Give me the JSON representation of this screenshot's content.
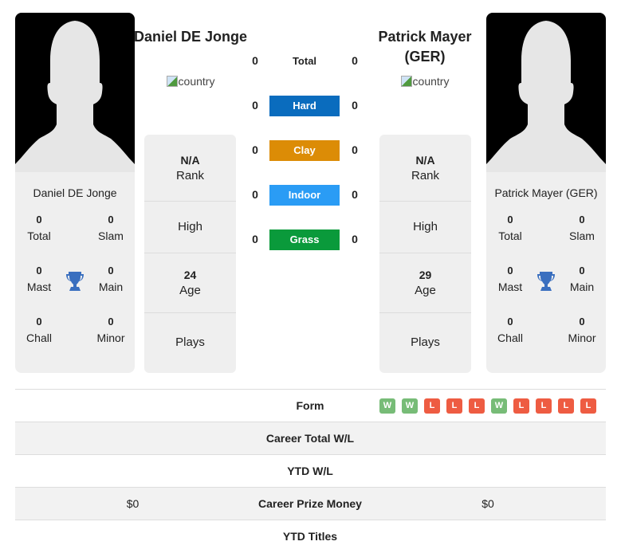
{
  "players": [
    {
      "heading_name": "Daniel DE Jonge",
      "card_name": "Daniel DE Jonge",
      "country_alt": "country",
      "rank": "N/A",
      "rank_label": "Rank",
      "high_label": "High",
      "age": "24",
      "age_label": "Age",
      "plays_label": "Plays",
      "titles": {
        "total": "0",
        "total_label": "Total",
        "slam": "0",
        "slam_label": "Slam",
        "mast": "0",
        "mast_label": "Mast",
        "main": "0",
        "main_label": "Main",
        "chall": "0",
        "chall_label": "Chall",
        "minor": "0",
        "minor_label": "Minor"
      }
    },
    {
      "heading_name": "Patrick Mayer (GER)",
      "card_name": "Patrick Mayer (GER)",
      "country_alt": "country",
      "rank": "N/A",
      "rank_label": "Rank",
      "high_label": "High",
      "age": "29",
      "age_label": "Age",
      "plays_label": "Plays",
      "titles": {
        "total": "0",
        "total_label": "Total",
        "slam": "0",
        "slam_label": "Slam",
        "mast": "0",
        "mast_label": "Mast",
        "main": "0",
        "main_label": "Main",
        "chall": "0",
        "chall_label": "Chall",
        "minor": "0",
        "minor_label": "Minor"
      }
    }
  ],
  "surfaces": [
    {
      "label": "Total",
      "left": "0",
      "right": "0",
      "color": ""
    },
    {
      "label": "Hard",
      "left": "0",
      "right": "0",
      "color": "#0a6cbe"
    },
    {
      "label": "Clay",
      "left": "0",
      "right": "0",
      "color": "#dc8c06"
    },
    {
      "label": "Indoor",
      "left": "0",
      "right": "0",
      "color": "#2a9cf5"
    },
    {
      "label": "Grass",
      "left": "0",
      "right": "0",
      "color": "#0a9a3b"
    }
  ],
  "form": {
    "label": "Form",
    "results": [
      "W",
      "W",
      "L",
      "L",
      "L",
      "W",
      "L",
      "L",
      "L",
      "L"
    ],
    "colors": {
      "W": "#77bc77",
      "L": "#ee5c42"
    }
  },
  "table": [
    {
      "label": "Career Total W/L",
      "left": "",
      "right": ""
    },
    {
      "label": "YTD W/L",
      "left": "",
      "right": ""
    },
    {
      "label": "Career Prize Money",
      "left": "$0",
      "right": "$0"
    },
    {
      "label": "YTD Titles",
      "left": "",
      "right": ""
    }
  ],
  "icons": {
    "trophy": "trophy-icon",
    "silhouette": "player-silhouette",
    "broken_image": "broken-image-icon"
  },
  "accent": {
    "trophy": "#3a6fbf"
  }
}
